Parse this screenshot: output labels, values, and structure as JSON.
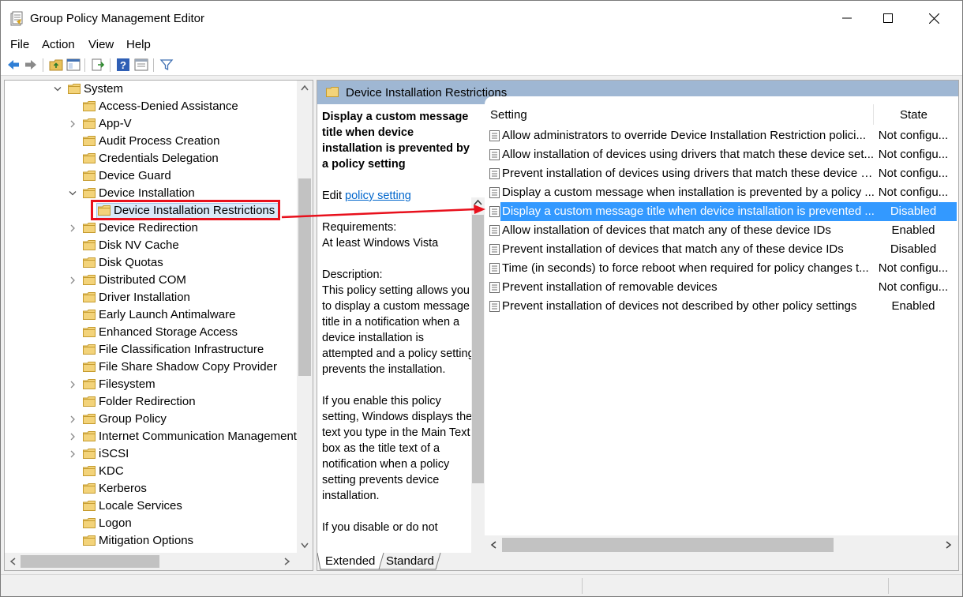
{
  "window": {
    "title": "Group Policy Management Editor",
    "controls": {
      "minimize": "—",
      "maximize": "☐",
      "close": "✕"
    }
  },
  "menu": [
    "File",
    "Action",
    "View",
    "Help"
  ],
  "toolbar": {
    "icons": [
      "back-arrow-icon",
      "forward-arrow-icon",
      "up-folder-icon",
      "show-hide-tree-icon",
      "export-list-icon",
      "help-icon",
      "properties-icon",
      "filter-icon"
    ]
  },
  "tree": {
    "items": [
      {
        "label": "System",
        "level": 0,
        "expander": "expanded"
      },
      {
        "label": "Access-Denied Assistance",
        "level": 1,
        "expander": "none"
      },
      {
        "label": "App-V",
        "level": 1,
        "expander": "collapsed"
      },
      {
        "label": "Audit Process Creation",
        "level": 1,
        "expander": "none"
      },
      {
        "label": "Credentials Delegation",
        "level": 1,
        "expander": "none"
      },
      {
        "label": "Device Guard",
        "level": 1,
        "expander": "none"
      },
      {
        "label": "Device Installation",
        "level": 1,
        "expander": "expanded"
      },
      {
        "label": "Device Installation Restrictions",
        "level": 2,
        "expander": "none",
        "selected": true
      },
      {
        "label": "Device Redirection",
        "level": 1,
        "expander": "collapsed"
      },
      {
        "label": "Disk NV Cache",
        "level": 1,
        "expander": "none"
      },
      {
        "label": "Disk Quotas",
        "level": 1,
        "expander": "none"
      },
      {
        "label": "Distributed COM",
        "level": 1,
        "expander": "collapsed"
      },
      {
        "label": "Driver Installation",
        "level": 1,
        "expander": "none"
      },
      {
        "label": "Early Launch Antimalware",
        "level": 1,
        "expander": "none"
      },
      {
        "label": "Enhanced Storage Access",
        "level": 1,
        "expander": "none"
      },
      {
        "label": "File Classification Infrastructure",
        "level": 1,
        "expander": "none"
      },
      {
        "label": "File Share Shadow Copy Provider",
        "level": 1,
        "expander": "none"
      },
      {
        "label": "Filesystem",
        "level": 1,
        "expander": "collapsed"
      },
      {
        "label": "Folder Redirection",
        "level": 1,
        "expander": "none"
      },
      {
        "label": "Group Policy",
        "level": 1,
        "expander": "collapsed"
      },
      {
        "label": "Internet Communication Management",
        "level": 1,
        "expander": "collapsed"
      },
      {
        "label": "iSCSI",
        "level": 1,
        "expander": "collapsed"
      },
      {
        "label": "KDC",
        "level": 1,
        "expander": "none"
      },
      {
        "label": "Kerberos",
        "level": 1,
        "expander": "none"
      },
      {
        "label": "Locale Services",
        "level": 1,
        "expander": "none"
      },
      {
        "label": "Logon",
        "level": 1,
        "expander": "none"
      },
      {
        "label": "Mitigation Options",
        "level": 1,
        "expander": "none"
      }
    ]
  },
  "right_panel": {
    "header": "Device Installation Restrictions",
    "description": {
      "title": "Display a custom message title when device installation is prevented by a policy setting",
      "edit_prefix": "Edit ",
      "edit_link": "policy setting ",
      "requirements_label": "Requirements:",
      "requirements_value": "At least Windows Vista",
      "description_label": "Description:",
      "para1": "This policy setting allows you to display a custom message title in a notification when a device installation is attempted and a policy setting prevents the installation.",
      "para2": "If you enable this policy setting, Windows displays the text you type in the Main Text box as the title text of a notification when a policy setting prevents device installation.",
      "para3": "If you disable or do not"
    },
    "columns": {
      "setting": "Setting",
      "state": "State"
    },
    "settings": [
      {
        "name": "Allow administrators to override Device Installation Restriction polici...",
        "state": "Not configu..."
      },
      {
        "name": "Allow installation of devices using drivers that match these device set...",
        "state": "Not configu..."
      },
      {
        "name": "Prevent installation of devices using drivers that match these device s...",
        "state": "Not configu..."
      },
      {
        "name": "Display a custom message when installation is prevented by a policy ...",
        "state": "Not configu..."
      },
      {
        "name": "Display a custom message title when device installation is prevented ...",
        "state": "Disabled",
        "selected": true
      },
      {
        "name": "Allow installation of devices that match any of these device IDs",
        "state": "Enabled"
      },
      {
        "name": "Prevent installation of devices that match any of these device IDs",
        "state": "Disabled"
      },
      {
        "name": "Time (in seconds) to force reboot when required for policy changes t...",
        "state": "Not configu..."
      },
      {
        "name": "Prevent installation of removable devices",
        "state": "Not configu..."
      },
      {
        "name": "Prevent installation of devices not described by other policy settings",
        "state": "Enabled"
      }
    ],
    "tabs": [
      "Extended",
      "Standard"
    ]
  },
  "colors": {
    "selection": "#3399ff",
    "header_band": "#9fb7d3",
    "annotation": "#e8101c",
    "link": "#0066cc"
  }
}
